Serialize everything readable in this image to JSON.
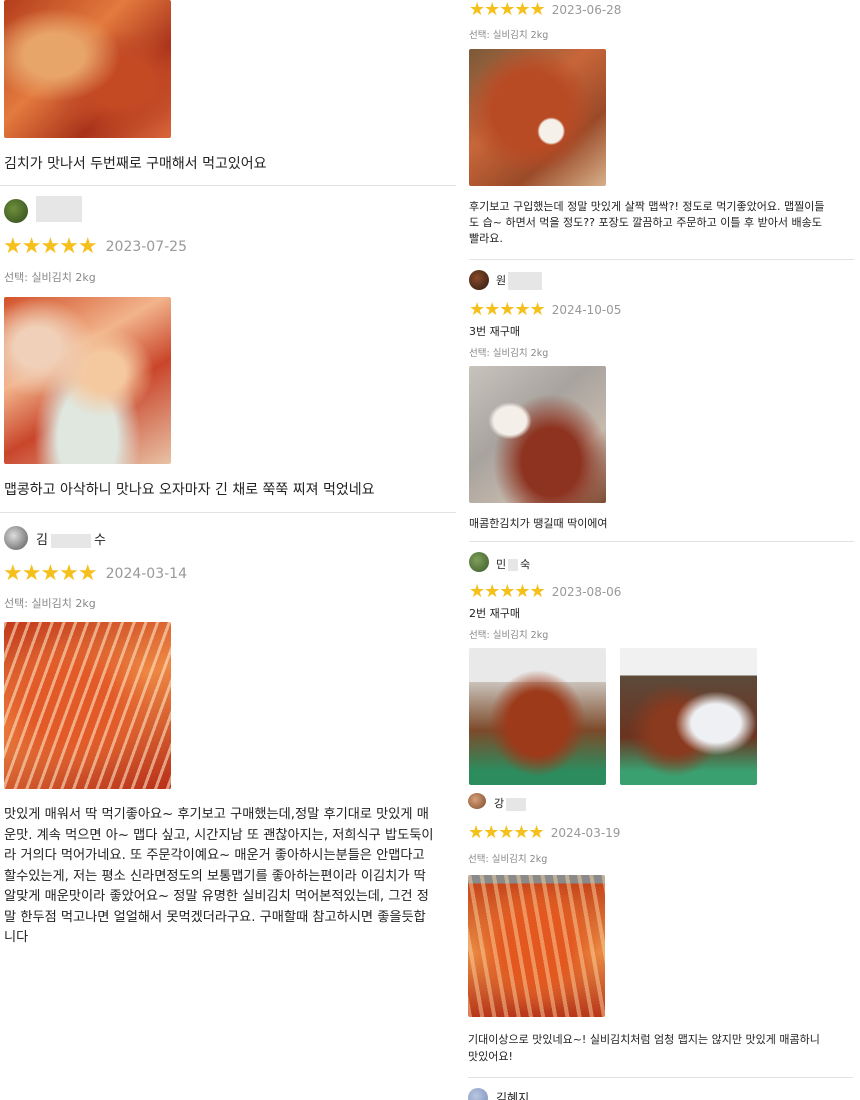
{
  "left": {
    "review0": {
      "text": "김치가 맛나서 두번째로 구매해서 먹고있어요"
    },
    "review1": {
      "stars": "★★★★★",
      "date": "2023-07-25",
      "option": "선택: 실비김치 2kg",
      "text": "맵콩하고 아삭하니 맛나요 오자마자 긴 채로 쭉쭉 찌져 먹었네요"
    },
    "review2": {
      "name": "김",
      "name_tail": "수",
      "stars": "★★★★★",
      "date": "2024-03-14",
      "option": "선택: 실비김치 2kg",
      "text_lines": [
        "맛있게 매워서 딱 먹기좋아요~ 후기보고 구매했는데,정말 후기대로 맛있게 매",
        "운맛. 계속 먹으면 아~ 맵다 싶고, 시간지남 또 괜찮아지는, 저희식구 밥도둑이",
        "라 거의다 먹어가네요. 또 주문각이예요~ 매운거 좋아하시는분들은 안맵다고",
        "할수있는게, 저는 평소 신라면정도의 보통맵기를 좋아하는편이라 이김치가 딱",
        "알맞게 매운맛이라 좋았어요~ 정말 유명한 실비김치 먹어본적있는데, 그건 정",
        "말 한두점 먹고나면 얼얼해서 못먹겠더라구요. 구매할때 참고하시면 좋을듯합",
        "니다"
      ]
    }
  },
  "right": {
    "review0": {
      "stars": "★★★★★",
      "date": "2023-06-28",
      "option": "선택: 실비김치 2kg",
      "text_lines": [
        "후기보고 구입했는데 정말 맛있게 살짝 맵싹?! 정도로 먹기좋았어요. 맵찔이들",
        "도 습~ 하면서 먹을 정도?? 포장도 깔끔하고 주문하고 이틀 후 받아서 배송도",
        "빨라요."
      ]
    },
    "review1": {
      "name": "원",
      "stars": "★★★★★",
      "date": "2024-10-05",
      "title": "3번 재구매",
      "option": "선택: 실비김치 2kg",
      "text": "매콤한김치가 땡길때 딱이에여"
    },
    "review2": {
      "name": "민",
      "name_tail": "숙",
      "stars": "★★★★★",
      "date": "2023-08-06",
      "title": "2번 재구매",
      "option": "선택: 실비김치 2kg"
    }
  },
  "bottom_right": {
    "review3": {
      "name": "강",
      "stars": "★★★★★",
      "date": "2024-03-19",
      "option": "선택: 실비김치 2kg",
      "text_lines": [
        "기대이상으로 맛있네요~! 실비김치처럼 엄청 맵지는 않지만 맛있게 매콤하니",
        "맛있어요!"
      ]
    },
    "review4": {
      "name": "김혜지"
    }
  }
}
